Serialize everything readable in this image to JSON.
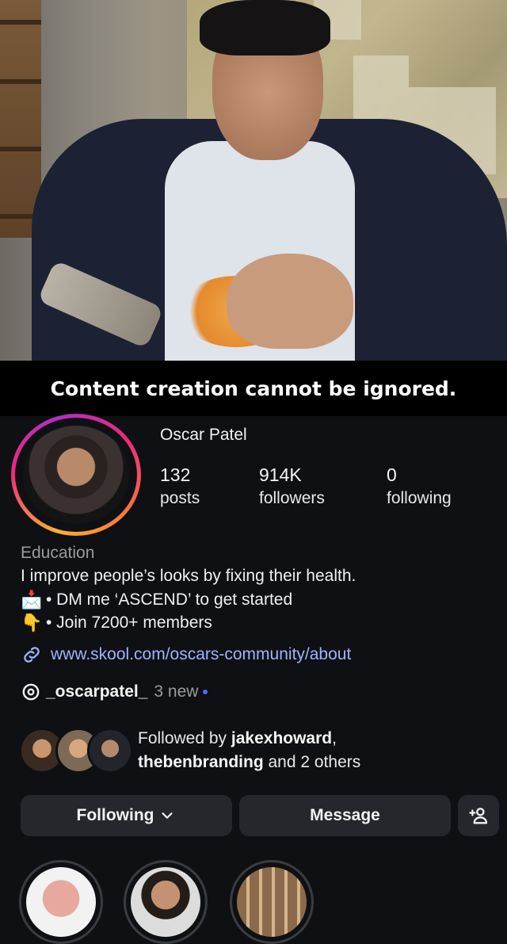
{
  "video": {
    "caption": "Content creation cannot be ignored."
  },
  "profile": {
    "name": "Oscar Patel",
    "stats": [
      {
        "value": "132",
        "label": "posts"
      },
      {
        "value": "914K",
        "label": "followers"
      },
      {
        "value": "0",
        "label": "following"
      }
    ],
    "category": "Education",
    "bio": "I improve people’s looks by fixing their health.",
    "bio_lines": [
      {
        "emoji": "📩",
        "text": "• DM me ‘ASCEND’ to get started"
      },
      {
        "emoji": "👇",
        "text": "• Join 7200+ members"
      }
    ],
    "link": "www.skool.com/oscars-community/about",
    "threads_handle": "_oscarpatel_",
    "threads_new": "3 new"
  },
  "followed_by": {
    "prefix": "Followed by ",
    "user1": "jakexhoward",
    "sep": ",",
    "user2": "thebenbranding",
    "suffix": " and 2 others"
  },
  "actions": {
    "following_label": "Following",
    "message_label": "Message"
  },
  "icons": {
    "link": "link-icon",
    "threads": "threads-icon",
    "chevron": "chevron-down-icon",
    "add_person": "add-person-icon"
  }
}
